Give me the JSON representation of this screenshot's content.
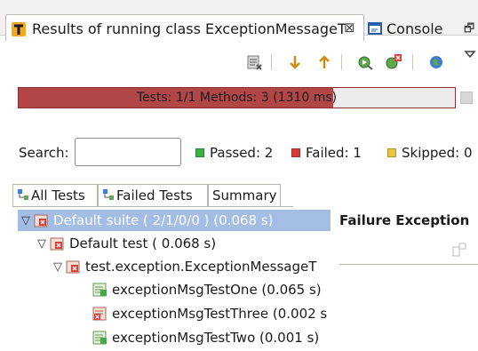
{
  "tabs": {
    "results_label": "Results of running class ExceptionMessageT",
    "close_glyph": "⊠",
    "console_label": "Console",
    "minimize_glyph": "🗗"
  },
  "toolbar": {
    "icons": [
      "clear-results-icon",
      "next-failure-icon",
      "previous-failure-icon",
      "rerun-icon",
      "rerun-failed-icon",
      "globe-icon",
      "view-menu-icon"
    ]
  },
  "progress": {
    "text": "Tests: 1/1  Methods: 3 (1310 ms)",
    "fill_fraction": 0.72,
    "color": "#b24646"
  },
  "search": {
    "label": "Search:",
    "value": ""
  },
  "stats": {
    "passed": "Passed: 2",
    "failed": "Failed: 1",
    "skipped": "Skipped: 0",
    "passed_color": "#3cb043",
    "failed_color": "#d93a3a",
    "skipped_color": "#e9c63c"
  },
  "subtabs": {
    "all": "All Tests",
    "failed": "Failed Tests",
    "summary": "Summary"
  },
  "tree": [
    {
      "label": "Default suite ( 2/1/0/0 ) (0.068 s)",
      "status": "failed"
    },
    {
      "label": "Default test ( 0.068 s)",
      "status": "failed"
    },
    {
      "label": "test.exception.ExceptionMessageT",
      "status": "failed"
    },
    {
      "label": "exceptionMsgTestOne  (0.065 s)",
      "status": "passed"
    },
    {
      "label": "exceptionMsgTestThree  (0.002 s",
      "status": "failed"
    },
    {
      "label": "exceptionMsgTestTwo  (0.001 s)",
      "status": "passed"
    }
  ],
  "failure": {
    "title": "Failure Exception"
  }
}
